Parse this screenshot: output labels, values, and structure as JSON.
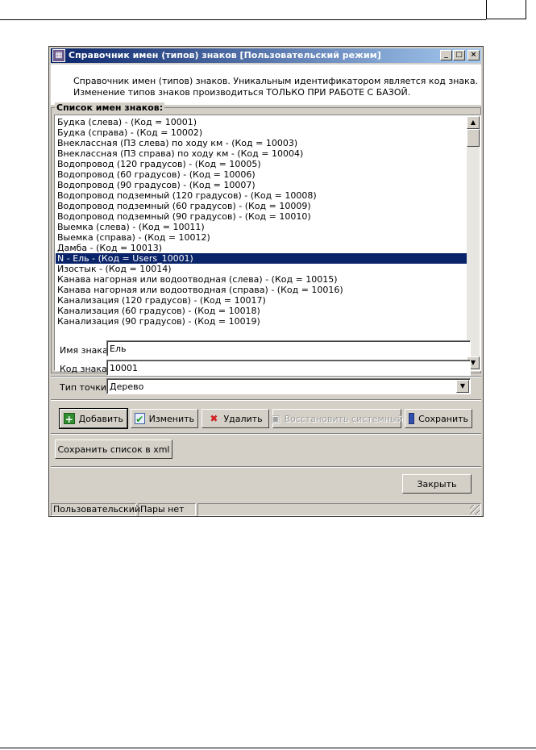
{
  "window": {
    "title": "Справочник имен (типов) знаков [Пользовательский режим]",
    "controls": {
      "minimize": "_",
      "maximize": "□",
      "close": "×"
    }
  },
  "info": {
    "line1": "Справочник имен (типов) знаков. Уникальным идентификатором является код знака.",
    "line2": "Изменение типов знаков производиться ТОЛЬКО ПРИ РАБОТЕ С БАЗОЙ."
  },
  "list": {
    "group_title": "Список имен знаков:",
    "items": [
      "Будка (слева) - (Код = 10001)",
      "Будка (справа) - (Код = 10002)",
      "Внеклассная (ПЗ слева) по ходу км - (Код = 10003)",
      "Внеклассная (ПЗ справа) по ходу км - (Код = 10004)",
      "Водопровод (120 градусов) - (Код = 10005)",
      "Водопровод (60 градусов) - (Код = 10006)",
      "Водопровод (90 градусов) - (Код = 10007)",
      "Водопровод подземный (120 градусов) - (Код = 10008)",
      "Водопровод подземный (60 градусов) - (Код = 10009)",
      "Водопровод подземный (90 градусов) - (Код = 10010)",
      "Выемка (слева) - (Код = 10011)",
      "Выемка (справа) - (Код = 10012)",
      "Дамба - (Код = 10013)",
      "N - Ель - (Код = Users_10001)",
      "Изостык - (Код = 10014)",
      "Канава нагорная или водоотводная (слева) - (Код = 10015)",
      "Канава нагорная или водоотводная (справа) - (Код = 10016)",
      "Канализация (120 градусов) - (Код = 10017)",
      "Канализация (60 градусов) - (Код = 10018)",
      "Канализация (90 градусов) - (Код = 10019)"
    ],
    "selected_index": 13
  },
  "form": {
    "name_label": "Имя знака:",
    "name_value": "Ель",
    "code_label": "Код знака:",
    "code_value": "10001",
    "point_type_label": "Тип точки:",
    "point_type_value": "Дерево"
  },
  "buttons": {
    "add": "Добавить",
    "edit": "Изменить",
    "delete": "Удалить",
    "restore": "Восстановить системный",
    "save": "Сохранить",
    "save_xml": "Сохранить список в xml",
    "close": "Закрыть"
  },
  "status": {
    "mode": "Пользовательский",
    "pairs": "Пары нет"
  },
  "colors": {
    "selection": "#0a246a",
    "titlebar_start": "#0a246a",
    "titlebar_end": "#a6caf0",
    "face": "#d4d0c8"
  }
}
